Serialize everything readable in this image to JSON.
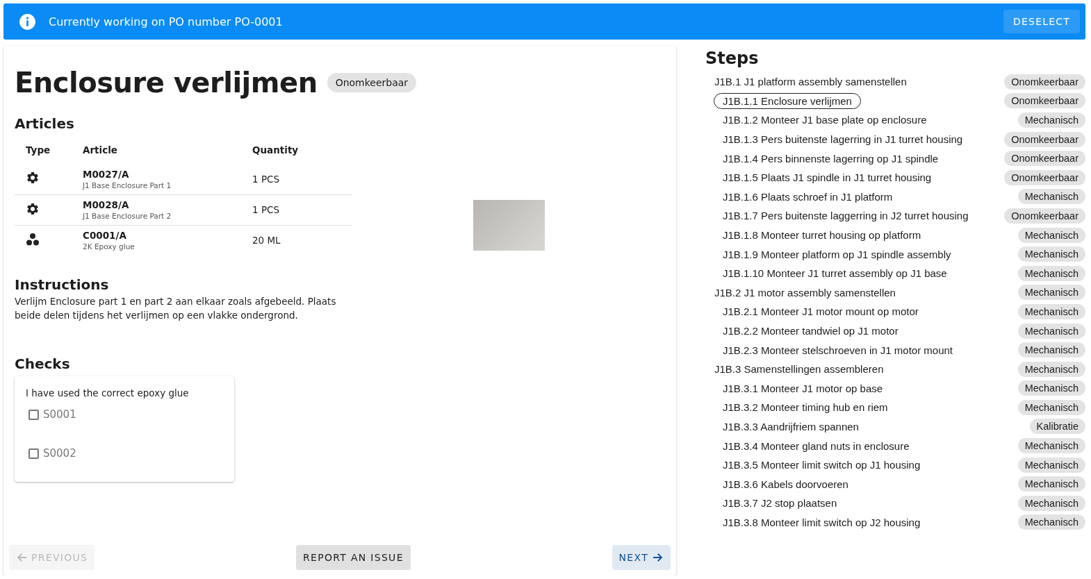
{
  "banner": {
    "message": "Currently working on PO number PO-0001",
    "action": "DESELECT"
  },
  "task": {
    "title": "Enclosure verlijmen",
    "tag": "Onomkeerbaar",
    "articles": {
      "heading": "Articles",
      "columns": [
        "Type",
        "Article",
        "Quantity"
      ],
      "rows": [
        {
          "kind": "part",
          "code": "M0027/A",
          "description": "J1 Base Enclosure Part 1",
          "quantity": "1 PCS"
        },
        {
          "kind": "part",
          "code": "M0028/A",
          "description": "J1 Base Enclosure Part 2",
          "quantity": "1 PCS"
        },
        {
          "kind": "consumable",
          "code": "C0001/A",
          "description": "2K Epoxy glue",
          "quantity": "20 ML"
        }
      ]
    },
    "instructions": {
      "heading": "Instructions",
      "text": "Verlijm Enclosure part 1 en part 2 aan elkaar zoals afgebeeld. Plaats beide delen tijdens het verlijmen op een vlakke ondergrond."
    },
    "checks": {
      "heading": "Checks",
      "question": "I have used the correct epoxy glue",
      "options": [
        {
          "label": "S0001",
          "checked": false
        },
        {
          "label": "S0002",
          "checked": false
        }
      ]
    },
    "buttons": [
      {
        "kind": "previous",
        "label": "PREVIOUS",
        "disabled": true
      },
      {
        "kind": "report",
        "label": "REPORT AN ISSUE",
        "disabled": false
      },
      {
        "kind": "next",
        "label": "NEXT",
        "disabled": false
      }
    ]
  },
  "steps": {
    "heading": "Steps",
    "items": [
      {
        "label": "J1B.1 J1 platform assembly samenstellen",
        "tag": "Onomkeerbaar",
        "selected": false,
        "children": [
          {
            "label": "J1B.1.1 Enclosure verlijmen",
            "tag": "Onomkeerbaar",
            "selected": true
          },
          {
            "label": "J1B.1.2 Monteer J1 base plate op enclosure",
            "tag": "Mechanisch",
            "selected": false
          },
          {
            "label": "J1B.1.3 Pers buitenste lagerring in J1 turret housing",
            "tag": "Onomkeerbaar",
            "selected": false
          },
          {
            "label": "J1B.1.4 Pers binnenste lagerring op J1 spindle",
            "tag": "Onomkeerbaar",
            "selected": false
          },
          {
            "label": "J1B.1.5 Plaats J1 spindle in J1 turret housing",
            "tag": "Onomkeerbaar",
            "selected": false
          },
          {
            "label": "J1B.1.6 Plaats schroef in J1 platform",
            "tag": "Mechanisch",
            "selected": false
          },
          {
            "label": "J1B.1.7 Pers buitenste laggerring in J2 turret housing",
            "tag": "Onomkeerbaar",
            "selected": false
          },
          {
            "label": "J1B.1.8 Monteer turret housing op platform",
            "tag": "Mechanisch",
            "selected": false
          },
          {
            "label": "J1B.1.9 Monteer platform op J1 spindle assembly",
            "tag": "Mechanisch",
            "selected": false
          },
          {
            "label": "J1B.1.10 Monteer J1 turret assembly op J1 base",
            "tag": "Mechanisch",
            "selected": false
          }
        ]
      },
      {
        "label": "J1B.2 J1 motor assembly samenstellen",
        "tag": "Mechanisch",
        "selected": false,
        "children": [
          {
            "label": "J1B.2.1 Monteer J1 motor mount op motor",
            "tag": "Mechanisch",
            "selected": false
          },
          {
            "label": "J1B.2.2 Monteer tandwiel op J1 motor",
            "tag": "Mechanisch",
            "selected": false
          },
          {
            "label": "J1B.2.3 Monteer stelschroeven in J1 motor mount",
            "tag": "Mechanisch",
            "selected": false
          }
        ]
      },
      {
        "label": "J1B.3 Samenstellingen assembleren",
        "tag": "Mechanisch",
        "selected": false,
        "children": [
          {
            "label": "J1B.3.1 Monteer J1 motor op base",
            "tag": "Mechanisch",
            "selected": false
          },
          {
            "label": "J1B.3.2 Monteer timing hub en riem",
            "tag": "Mechanisch",
            "selected": false
          },
          {
            "label": "J1B.3.3 Aandrijfriem spannen",
            "tag": "Kalibratie",
            "selected": false
          },
          {
            "label": "J1B.3.4 Monteer gland nuts in enclosure",
            "tag": "Mechanisch",
            "selected": false
          },
          {
            "label": "J1B.3.5 Monteer limit switch op J1 housing",
            "tag": "Mechanisch",
            "selected": false
          },
          {
            "label": "J1B.3.6 Kabels doorvoeren",
            "tag": "Mechanisch",
            "selected": false
          },
          {
            "label": "J1B.3.7 J2 stop plaatsen",
            "tag": "Mechanisch",
            "selected": false
          },
          {
            "label": "J1B.3.8 Monteer limit switch op J2 housing",
            "tag": "Mechanisch",
            "selected": false
          }
        ]
      }
    ]
  }
}
